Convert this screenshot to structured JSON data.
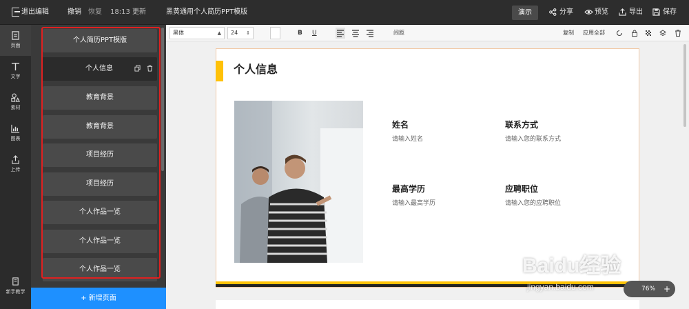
{
  "topbar": {
    "exit_label": "退出编辑",
    "undo_label": "撤销",
    "redo_label": "恢复",
    "update_time": "18:13 更新",
    "doc_title": "黑黄通用个人简历PPT模版",
    "demo_label": "演示",
    "share_label": "分享",
    "preview_label": "预览",
    "export_label": "导出",
    "save_label": "保存"
  },
  "rail": {
    "items": [
      {
        "label": "页面",
        "icon": "page-icon"
      },
      {
        "label": "文字",
        "icon": "text-icon"
      },
      {
        "label": "素材",
        "icon": "shapes-icon"
      },
      {
        "label": "图表",
        "icon": "chart-icon"
      },
      {
        "label": "上传",
        "icon": "upload-icon"
      }
    ],
    "tutorial_label": "新手教学"
  },
  "pages": {
    "items": [
      "个人简历PPT模版",
      "个人信息",
      "教育背景",
      "教育背景",
      "项目经历",
      "项目经历",
      "个人作品一览",
      "个人作品一览",
      "个人作品一览"
    ],
    "active_index": 1,
    "add_label": "+ 新增页面"
  },
  "format": {
    "font": "黑体",
    "size": "24",
    "bold": "B",
    "underline": "U",
    "spacing_label": "间距",
    "copy_label": "复制",
    "apply_all_label": "应用全部"
  },
  "slide": {
    "title": "个人信息",
    "fields": [
      {
        "label": "姓名",
        "placeholder": "请输入姓名"
      },
      {
        "label": "联系方式",
        "placeholder": "请输入您的联系方式"
      },
      {
        "label": "最高学历",
        "placeholder": "请输入最高学历"
      },
      {
        "label": "应聘职位",
        "placeholder": "请输入您的应聘职位"
      }
    ]
  },
  "zoom": {
    "value": "76%",
    "plus": "+"
  },
  "watermark": {
    "text": "Baidu经验",
    "url": "jingyan.baidu.com"
  },
  "colors": {
    "accent": "#ffc107",
    "primary": "#1e90ff",
    "highlight": "#e02020"
  }
}
